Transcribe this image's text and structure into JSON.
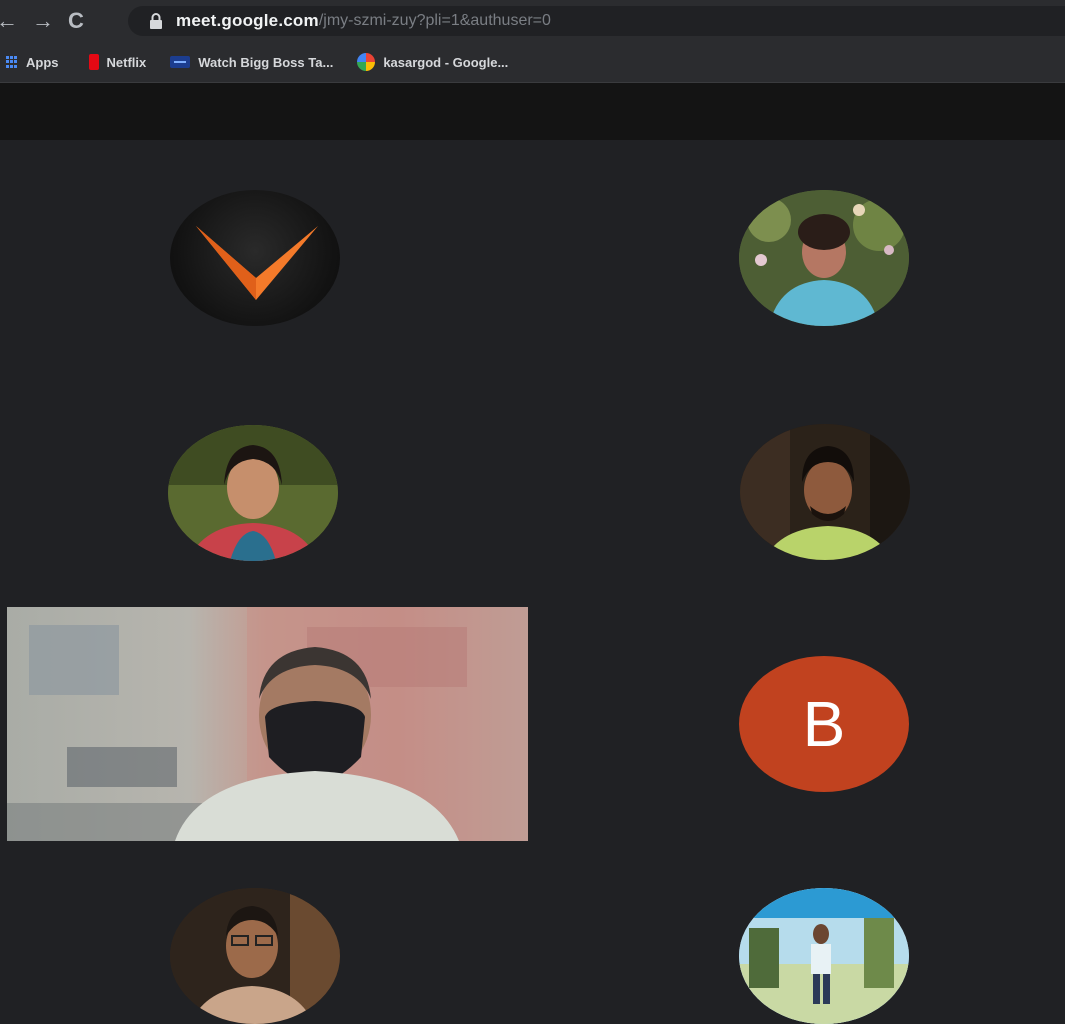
{
  "browser": {
    "url_host": "meet.google.com",
    "url_path": "/jmy-szmi-zuy?pli=1&authuser=0",
    "bookmarks": [
      {
        "label": "Apps",
        "icon": "apps-grid-icon"
      },
      {
        "label": "Netflix",
        "icon": "netflix-icon"
      },
      {
        "label": "Watch Bigg Boss Ta...",
        "icon": "tv-icon"
      },
      {
        "label": "kasargod - Google...",
        "icon": "google-icon"
      }
    ]
  },
  "participants": [
    {
      "type": "logo-avatar",
      "icon": "orange-chevron-logo-icon"
    },
    {
      "type": "photo-avatar"
    },
    {
      "type": "photo-avatar"
    },
    {
      "type": "photo-avatar"
    },
    {
      "type": "video"
    },
    {
      "type": "letter-avatar",
      "letter": "B",
      "color": "#c1421f"
    },
    {
      "type": "photo-avatar"
    },
    {
      "type": "photo-avatar"
    }
  ],
  "colors": {
    "background": "#202124",
    "topbar": "#141414",
    "logo_orange": "#f47a2a"
  }
}
